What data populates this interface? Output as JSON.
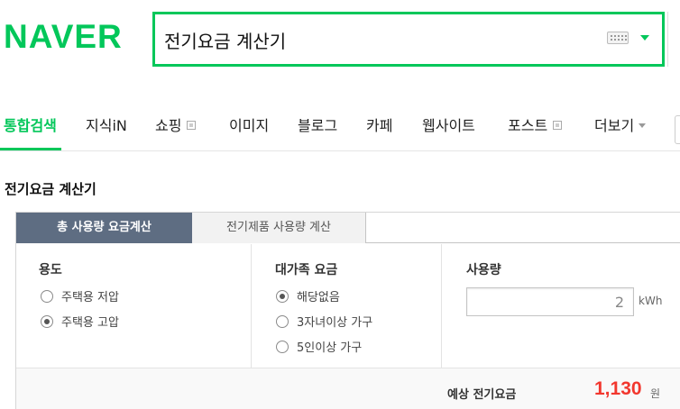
{
  "header": {
    "logo": "NAVER",
    "search_value": "전기요금 계산기"
  },
  "nav": {
    "items": [
      {
        "label": "통합검색",
        "active": true
      },
      {
        "label": "지식iN"
      },
      {
        "label": "쇼핑",
        "icon": "external-box-icon"
      },
      {
        "label": "이미지"
      },
      {
        "label": "블로그"
      },
      {
        "label": "카페"
      },
      {
        "label": "웹사이트"
      },
      {
        "label": "포스트",
        "icon": "external-box-icon"
      },
      {
        "label": "더보기",
        "icon": "caret-down-icon"
      }
    ]
  },
  "section": {
    "title": "전기요금 계산기"
  },
  "calculator": {
    "tabs": [
      "총 사용량 요금계산",
      "전기제품 사용량 계산"
    ],
    "purpose": {
      "heading": "용도",
      "options": [
        {
          "label": "주택용 저압",
          "selected": false
        },
        {
          "label": "주택용 고압",
          "selected": true
        }
      ]
    },
    "family": {
      "heading": "대가족 요금",
      "options": [
        {
          "label": "해당없음",
          "selected": true
        },
        {
          "label": "3자녀이상 가구",
          "selected": false
        },
        {
          "label": "5인이상 가구",
          "selected": false
        }
      ]
    },
    "usage": {
      "heading": "사용량",
      "value": "2",
      "unit": "kWh"
    },
    "result": {
      "label": "예상 전기요금",
      "value": "1,130",
      "unit": "원"
    }
  },
  "colors": {
    "brand": "#03c75a",
    "active_tab": "#5e6d82",
    "result": "#f2372e"
  }
}
